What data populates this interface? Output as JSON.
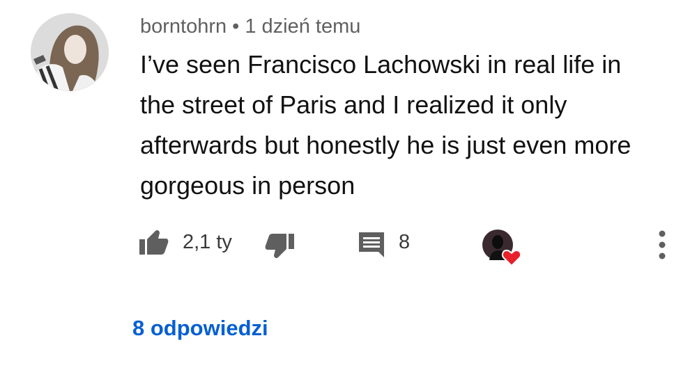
{
  "comment": {
    "author": "borntohrn",
    "separator": "•",
    "time": "1 dzień temu",
    "text": "I’ve seen Francisco Lachowski in real life in the street of Paris and I realized it only afterwards but honestly he is just even more gorgeous in person"
  },
  "actions": {
    "like_count": "2,1 ty",
    "reply_count": "8"
  },
  "replies": {
    "label": "8 odpowiedzi"
  },
  "colors": {
    "link": "#065fd4",
    "heart": "#e8202b",
    "icon": "#5f5f5f"
  },
  "icons": {
    "like": "thumb-up-icon",
    "dislike": "thumb-down-icon",
    "reply": "comment-icon",
    "creator_heart": "creator-heart-icon",
    "menu": "more-vertical-icon"
  }
}
